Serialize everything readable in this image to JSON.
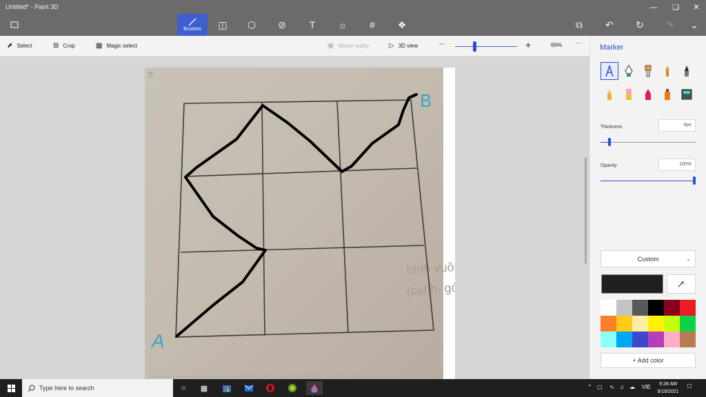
{
  "window": {
    "title": "Untitled* - Paint 3D"
  },
  "ribbon": {
    "brushes_label": "Brushes",
    "tools": [
      "menu-icon",
      "brushes-icon",
      "2d-shapes-icon",
      "3d-shapes-icon",
      "stickers-icon",
      "text-icon",
      "effects-icon",
      "canvas-icon",
      "3d-library-icon"
    ],
    "right_tools": [
      "paste-icon",
      "undo-icon",
      "history-icon",
      "redo-icon",
      "expand-icon"
    ]
  },
  "toolbar": {
    "select_label": "Select",
    "crop_label": "Crop",
    "magic_select_label": "Magic select",
    "mixed_reality_label": "Mixed reality",
    "view3d_label": "3D view",
    "zoom_minus": "—",
    "zoom_plus": "+",
    "zoom_value": "66%",
    "more": "···",
    "zoom_level": 0.3
  },
  "drawing": {
    "label_a": "A",
    "label_b": "B",
    "faint_texts": [
      "hình vuông, hãy",
      "(cạnh, góc) của"
    ],
    "ink_color": "#000000",
    "label_color": "#3aa6c4"
  },
  "panel": {
    "title": "Marker",
    "tools": [
      {
        "name": "marker",
        "selected": true
      },
      {
        "name": "calligraphy-pen"
      },
      {
        "name": "oil-brush"
      },
      {
        "name": "watercolor"
      },
      {
        "name": "pixel-pen"
      },
      {
        "name": "pencil"
      },
      {
        "name": "eraser"
      },
      {
        "name": "crayon"
      },
      {
        "name": "spraycan"
      },
      {
        "name": "fill"
      }
    ],
    "thickness_label": "Thickness",
    "thickness_value": "8px",
    "thickness_level": 0.08,
    "opacity_label": "Opacity",
    "opacity_value": "100%",
    "opacity_level": 1.0,
    "color_mode": "Custom",
    "current_color": "#1f1f1f",
    "palette": [
      "#ffffff",
      "#c3c3c3",
      "#585858",
      "#000000",
      "#88001b",
      "#ec1c24",
      "#ff7f27",
      "#ffca18",
      "#fdeca6",
      "#fff200",
      "#c4ff0e",
      "#0ed145",
      "#8cfffb",
      "#00a8f3",
      "#3f48cc",
      "#b83dba",
      "#ffaec8",
      "#b97a56"
    ],
    "add_color_label": "Add color"
  },
  "taskbar": {
    "search_placeholder": "Type here to search",
    "apps": [
      "task-view-icon",
      "widgets-icon",
      "store-icon",
      "mail-icon",
      "opera-icon",
      "browser-icon",
      "paint3d-icon"
    ],
    "language": "VIE",
    "time": "9:28 AM",
    "date": "9/19/2021"
  }
}
